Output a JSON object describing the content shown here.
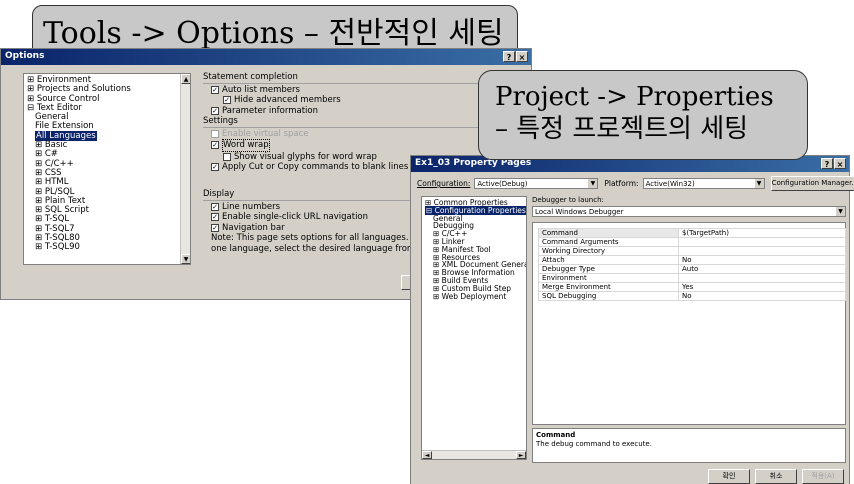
{
  "callouts": {
    "options": "Tools -> Options – 전반적인 세팅",
    "project_line1": "Project -> Properties",
    "project_line2": "– 특정 프로젝트의 세팅"
  },
  "options_dialog": {
    "title": "Options",
    "titlebar_buttons": [
      "?",
      "×"
    ],
    "tree": [
      "⊞ Environment",
      "⊞ Projects and Solutions",
      "⊞ Source Control",
      "⊟ Text Editor",
      "General",
      "File Extension",
      "All Languages",
      "⊞ Basic",
      "⊞ C#",
      "⊞ C/C++",
      "⊞ CSS",
      "⊞ HTML",
      "⊞ PL/SQL",
      "⊞ Plain Text",
      "⊞ SQL Script",
      "⊞ T-SQL",
      "⊞ T-SQL7",
      "⊞ T-SQL80",
      "⊞ T-SQL90"
    ],
    "statement_completion": {
      "header": "Statement completion",
      "auto_list": "Auto list members",
      "hide_advanced": "Hide advanced members",
      "parameter_info": "Parameter information"
    },
    "settings": {
      "header": "Settings",
      "virtual_space": "Enable virtual space",
      "word_wrap": "Word wrap",
      "show_glyphs": "Show visual glyphs for word wrap",
      "apply_cut": "Apply Cut or Copy commands to blank lines w"
    },
    "display": {
      "header": "Display",
      "line_numbers": "Line numbers",
      "single_click": "Enable single-click URL navigation",
      "navigation_bar": "Navigation bar",
      "note1": "Note: This page sets options for all languages. To",
      "note2": "one language, select the desired language from th"
    }
  },
  "property_pages": {
    "title": "Ex1_03 Property Pages",
    "titlebar_buttons": [
      "?",
      "×"
    ],
    "configuration_label": "Configuration:",
    "configuration_value": "Active(Debug)",
    "platform_label": "Platform:",
    "platform_value": "Active(Win32)",
    "config_manager": "Configuration Manager...",
    "tree": [
      "⊞ Common Properties",
      "⊟ Configuration Properties",
      "General",
      "Debugging",
      "⊞ C/C++",
      "⊞ Linker",
      "⊞ Manifest Tool",
      "⊞ Resources",
      "⊞ XML Document Generato",
      "⊞ Browse Information",
      "⊞ Build Events",
      "⊞ Custom Build Step",
      "⊞ Web Deployment"
    ],
    "debugger_label": "Debugger to launch:",
    "debugger_value": "Local Windows Debugger",
    "grid": [
      {
        "name": "Command",
        "value": "$(TargetPath)"
      },
      {
        "name": "Command Arguments",
        "value": ""
      },
      {
        "name": "Working Directory",
        "value": ""
      },
      {
        "name": "Attach",
        "value": "No"
      },
      {
        "name": "Debugger Type",
        "value": "Auto"
      },
      {
        "name": "Environment",
        "value": ""
      },
      {
        "name": "Merge Environment",
        "value": "Yes"
      },
      {
        "name": "SQL Debugging",
        "value": "No"
      }
    ],
    "desc_title": "Command",
    "desc_text": "The debug command to execute.",
    "buttons": {
      "ok": "확인",
      "cancel": "취소",
      "apply": "적용(A)"
    }
  }
}
